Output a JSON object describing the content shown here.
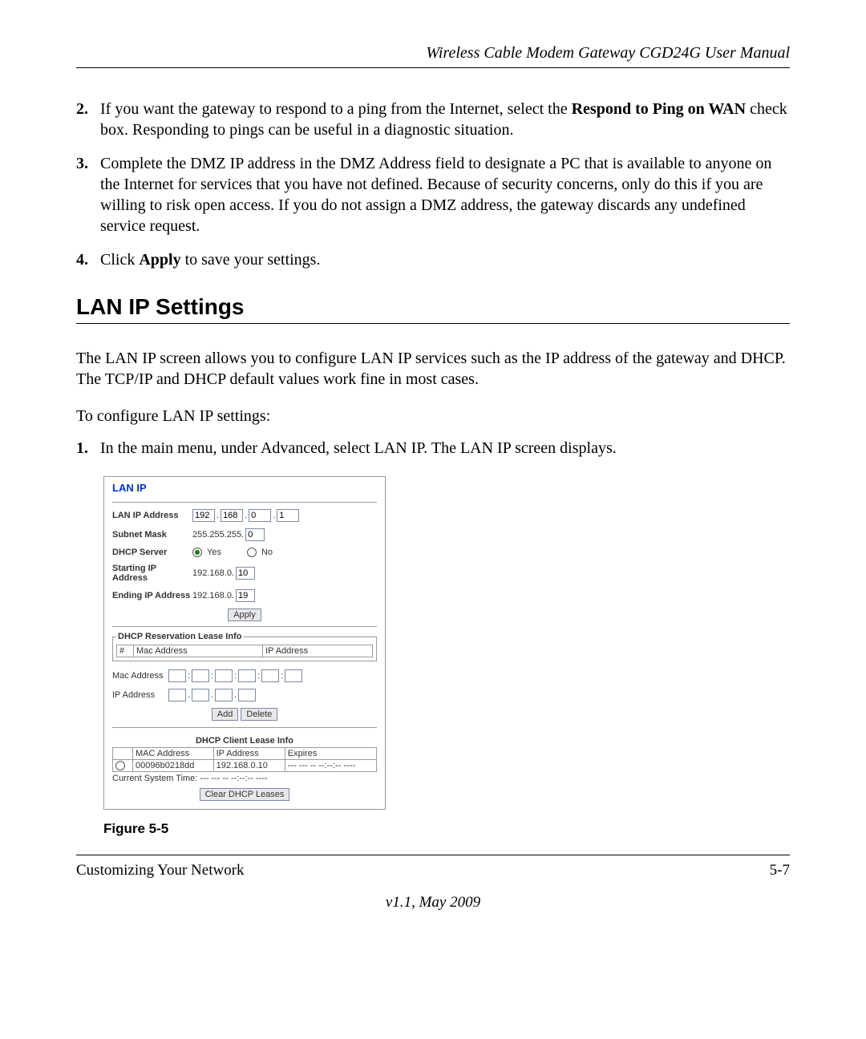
{
  "header": {
    "title": "Wireless Cable Modem Gateway CGD24G User Manual"
  },
  "steps_top": [
    {
      "num": "2.",
      "text_pre": "If you want the gateway to respond to a ping from the Internet, select the ",
      "bold1": "Respond to Ping on WAN",
      "text_mid": " check box. Responding to pings can be useful in a diagnostic situation."
    },
    {
      "num": "3.",
      "text": "Complete the DMZ IP address in the DMZ Address field to designate a PC that is available to anyone on the Internet for services that you have not defined. Because of security concerns, only do this if you are willing to risk open access. If you do not assign a DMZ address, the gateway discards any undefined service request."
    },
    {
      "num": "4.",
      "text_pre": "Click ",
      "bold1": "Apply",
      "text_mid": " to save your settings."
    }
  ],
  "section_title": "LAN IP Settings",
  "intro1": "The LAN IP screen allows you to configure LAN IP services such as the IP address of the gateway and DHCP. The TCP/IP and DHCP default values work fine in most cases.",
  "intro2": "To configure LAN IP settings:",
  "step1": {
    "num": "1.",
    "text": "In the main menu, under Advanced, select LAN IP. The LAN IP screen displays."
  },
  "lan": {
    "title": "LAN IP",
    "ip_label": "LAN IP Address",
    "ip": [
      "192",
      "168",
      "0",
      "1"
    ],
    "mask_label": "Subnet Mask",
    "mask_prefix": "255.255.255.",
    "mask_last": "0",
    "dhcp_label": "DHCP Server",
    "yes": "Yes",
    "no": "No",
    "start_label": "Starting IP Address",
    "start_prefix": "192.168.0.",
    "start_val": "10",
    "end_label": "Ending IP Address",
    "end_prefix": "192.168.0.",
    "end_val": "19",
    "apply": "Apply",
    "reserv_legend": "DHCP Reservation Lease Info",
    "col_hash": "#",
    "col_mac": "Mac Address",
    "col_ip": "IP Address",
    "mac_label": "Mac Address",
    "ip_addr_label": "IP Address",
    "add": "Add",
    "delete": "Delete",
    "client_legend": "DHCP Client Lease Info",
    "col_mac2": "MAC Address",
    "col_ip2": "IP Address",
    "col_exp": "Expires",
    "row_mac": "00096b0218dd",
    "row_ip": "192.168.0.10",
    "row_exp": "--- --- -- --:--:-- ----",
    "systime": "Current System Time: --- --- -- --:--:-- ----",
    "clear": "Clear DHCP Leases"
  },
  "figure_caption": "Figure 5-5",
  "footer": {
    "left": "Customizing Your Network",
    "right": "5-7"
  },
  "version": "v1.1, May 2009"
}
